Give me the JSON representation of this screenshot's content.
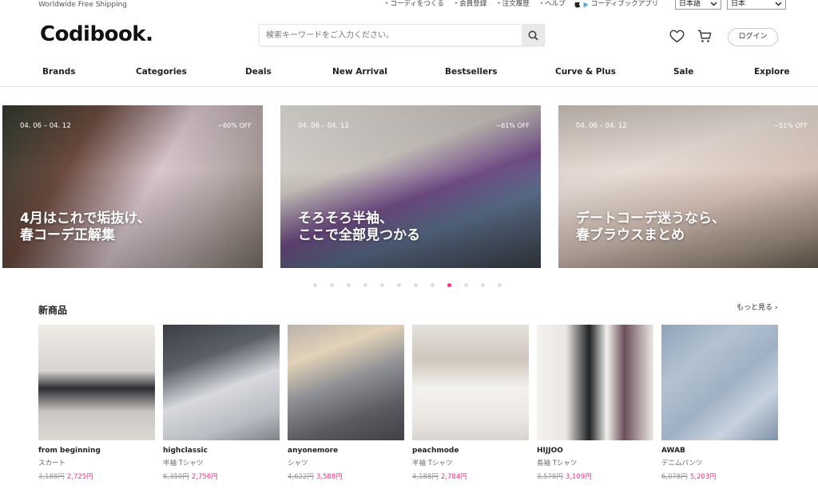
{
  "topbar": {
    "shipping": "Worldwide Free Shipping",
    "links": [
      "・コーディをつくる",
      "・会員登録",
      "・注文履歴",
      "・ヘルプ"
    ],
    "app_link": "コーディブックアプリ",
    "language": "日本語",
    "country": "日本"
  },
  "header": {
    "logo": "Codibook.",
    "search_placeholder": "検索キーワードをご入力ください。",
    "login_label": "ログイン"
  },
  "nav": [
    "Brands",
    "Categories",
    "Deals",
    "New Arrival",
    "Bestsellers",
    "Curve & Plus",
    "Sale",
    "Explore"
  ],
  "banners": [
    {
      "date": "04. 06 – 04. 12",
      "discount": "~60% OFF",
      "line1": "4月はこれで垢抜け、",
      "line2": "春コーデ正解集"
    },
    {
      "date": "04. 06 – 04. 12",
      "discount": "~61% OFF",
      "line1": "そろそろ半袖、",
      "line2": "ここで全部見つかる"
    },
    {
      "date": "04. 06 – 04. 12",
      "discount": "~51% OFF",
      "line1": "デートコーデ迷うなら、",
      "line2": "春ブラウスまとめ"
    }
  ],
  "carousel": {
    "total": 12,
    "active": 8
  },
  "new_items": {
    "title": "新商品",
    "more": "もっと見る ›",
    "products": [
      {
        "brand": "from beginning",
        "category": "スカート",
        "old_price": "3,188円",
        "price": "2,725円"
      },
      {
        "brand": "highclassic",
        "category": "半袖 Tシャツ",
        "old_price": "6,359円",
        "price": "2,756円"
      },
      {
        "brand": "anyonemore",
        "category": "シャツ",
        "old_price": "4,622円",
        "price": "3,588円"
      },
      {
        "brand": "peachmode",
        "category": "半袖 Tシャツ",
        "old_price": "4,188円",
        "price": "2,784円"
      },
      {
        "brand": "HIJJOO",
        "category": "長袖 Tシャツ",
        "old_price": "3,578円",
        "price": "3,109円"
      },
      {
        "brand": "AWAB",
        "category": "デニムパンツ",
        "old_price": "6,078円",
        "price": "5,203円"
      }
    ]
  },
  "colors": {
    "accent": "#ff2d8a",
    "text": "#222222"
  }
}
